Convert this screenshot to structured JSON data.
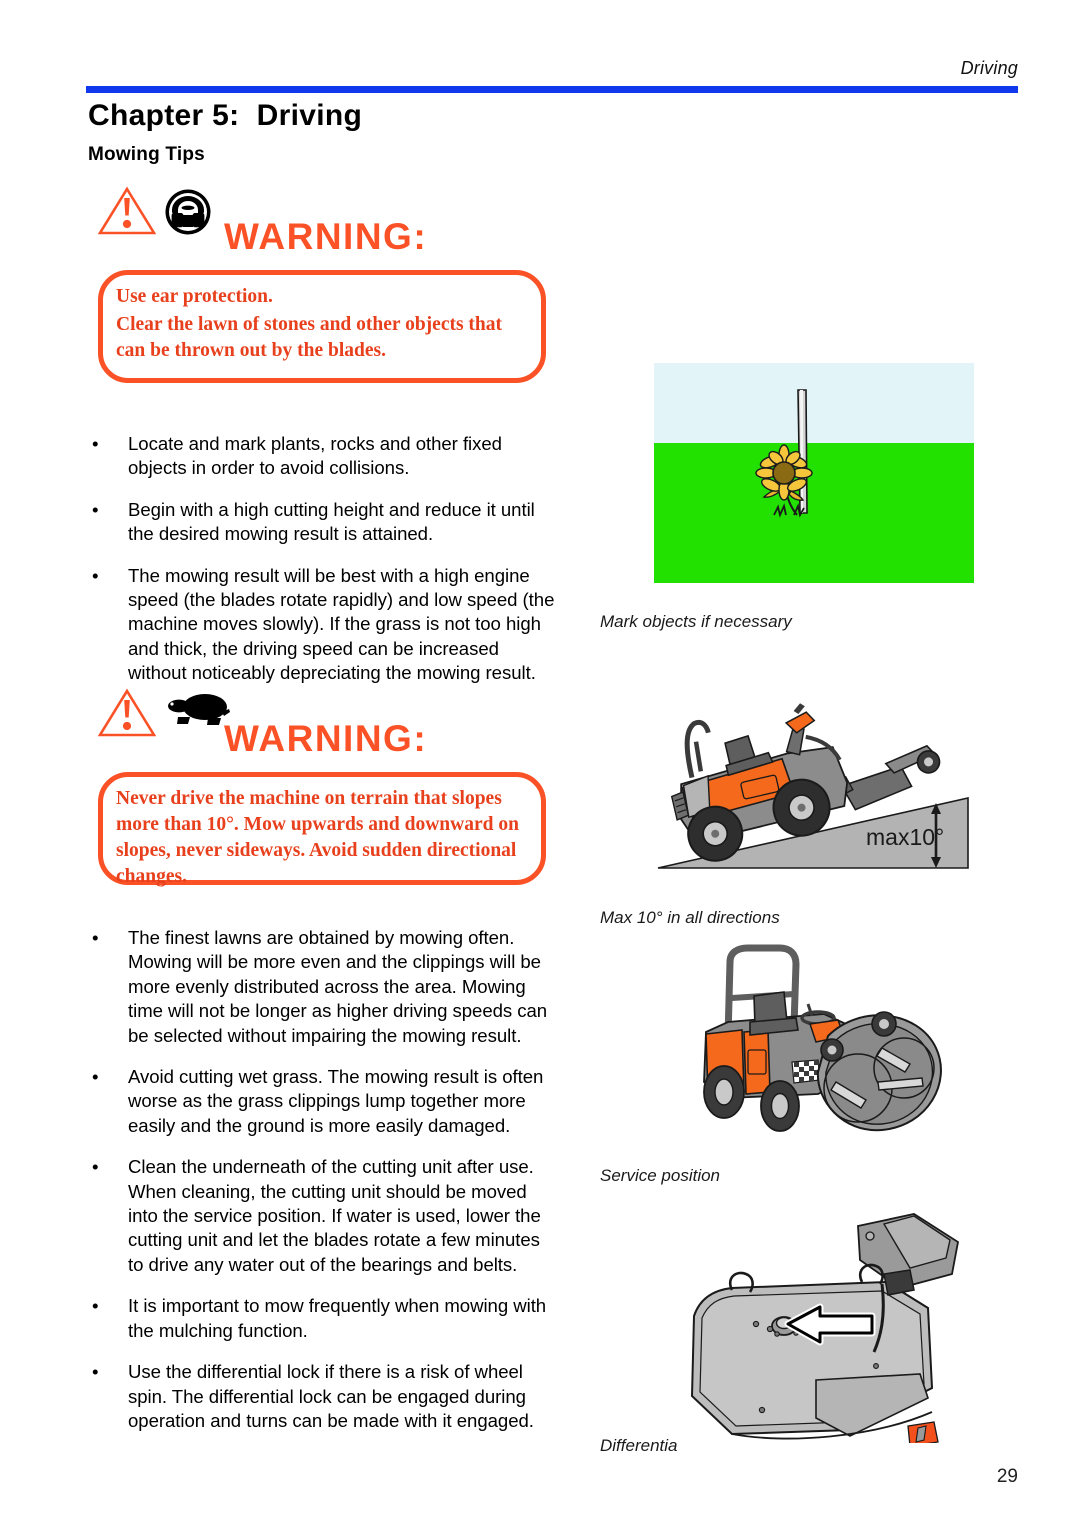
{
  "header": {
    "running_title": "Driving",
    "rule_color": "#1238ee"
  },
  "chapter": {
    "title": "Chapter 5:  Driving",
    "section": "Mowing Tips"
  },
  "colors": {
    "warning_orange": "#fa5226",
    "warning_text_orange": "#e8401c",
    "header_blue": "#1238ee",
    "grass_green": "#22e000",
    "sky_blue": "#e2f4f8",
    "machine_orange": "#f4691c",
    "machine_grey": "#8c8c8c",
    "slope_grey": "#b3b3b3"
  },
  "warnings": [
    {
      "id": "warning-ear-protection",
      "heading": "WARNING:",
      "icons": [
        "warning-triangle-icon",
        "ear-protection-icon"
      ],
      "lines": [
        "Use ear protection.",
        "Clear the lawn of stones and other objects that can be thrown out by the blades."
      ]
    },
    {
      "id": "warning-slope",
      "heading": "WARNING:",
      "icons": [
        "warning-triangle-icon",
        "turtle-slow-icon"
      ],
      "lines": [
        "Never drive the machine on terrain that slopes more than 10°. Mow upwards and downward on slopes, never sideways. Avoid sudden directional changes."
      ]
    }
  ],
  "bullets_top": [
    "Locate and mark plants, rocks and other fixed objects in order to avoid collisions.",
    "Begin with a high cutting height and reduce it until the desired mowing result is attained.",
    "The mowing result will be best with a high engine speed (the blades rotate rapidly) and low speed (the machine moves slowly). If the grass is not too high and thick, the driving speed can be increased without noticeably depreciating the mowing result."
  ],
  "bullets_bottom": [
    "The finest lawns are obtained by mowing often. Mowing will be more even and the clippings will be more evenly distributed across the area. Mowing time will not be longer as higher driving speeds can be selected without impairing the mowing result.",
    "Avoid cutting wet grass. The mowing result is often worse as the grass clippings lump together more easily and the ground is more easily damaged.",
    "Clean the underneath of the cutting unit after use. When cleaning, the cutting unit should be moved into the service position. If water is used, lower the cutting unit and let the blades rotate a few minutes to drive any water out of the bearings and belts.",
    "It is important to mow frequently when mowing with the mulching function.",
    "Use the differential lock if there is a risk of wheel spin. The differential lock can be engaged during operation and turns can be made with it engaged."
  ],
  "bullet_marker": "•",
  "figures": [
    {
      "id": "figure-mark-objects",
      "caption": "Mark objects if necessary",
      "annotation": ""
    },
    {
      "id": "figure-slope",
      "caption": "Max 10° in all directions",
      "annotation": "max10°"
    },
    {
      "id": "figure-service-position",
      "caption": "Service position",
      "annotation": ""
    },
    {
      "id": "figure-differential-lock",
      "caption": "Differentia",
      "annotation": ""
    }
  ],
  "page_number": "29"
}
